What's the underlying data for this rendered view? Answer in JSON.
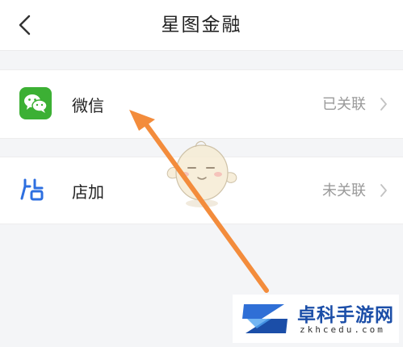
{
  "header": {
    "title": "星图金融"
  },
  "accounts": [
    {
      "name": "微信",
      "status": "已关联",
      "icon": "wechat-icon"
    },
    {
      "name": "店加",
      "status": "未关联",
      "icon": "dianjia-icon"
    }
  ],
  "annotation": {
    "arrow_color": "#f38c3c",
    "points_to": "微信"
  },
  "watermark": {
    "title": "卓科手游网",
    "url": "zkhcedu.com"
  },
  "colors": {
    "wechat_green": "#3cb034",
    "dianjia_blue": "#2d6fe0",
    "status_gray": "#9a9a9a",
    "background": "#f4f5f7"
  }
}
